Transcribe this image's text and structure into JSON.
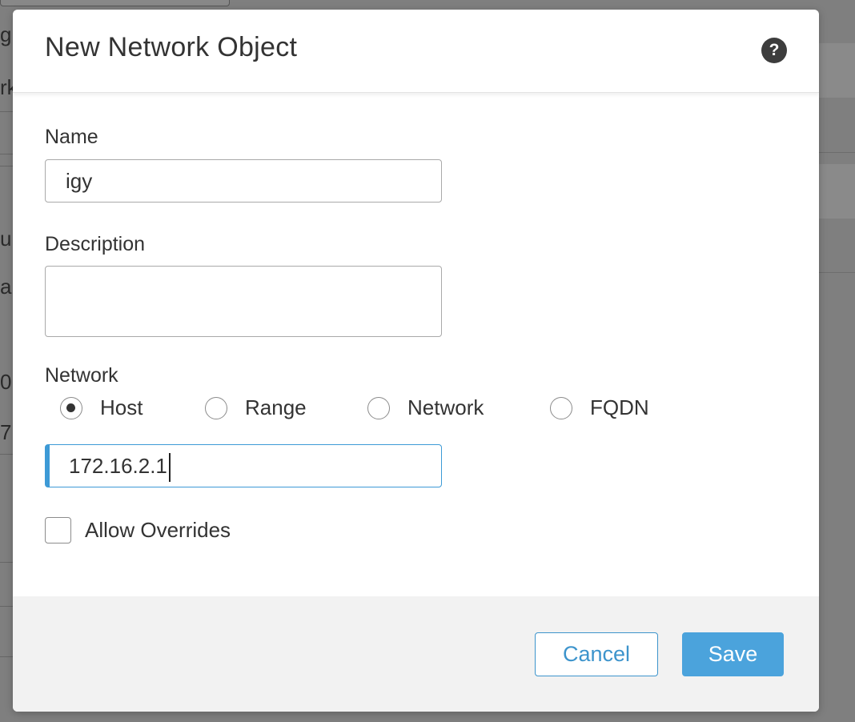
{
  "background": {
    "fragments": [
      "g",
      "rk",
      "ur",
      "al",
      "0",
      "7"
    ]
  },
  "dialog": {
    "title": "New Network Object",
    "help_icon": "question-mark-icon",
    "name": {
      "label": "Name",
      "value": "igy"
    },
    "description": {
      "label": "Description",
      "value": ""
    },
    "network": {
      "label": "Network",
      "options": [
        "Host",
        "Range",
        "Network",
        "FQDN"
      ],
      "selected": "Host",
      "value": "172.16.2.1"
    },
    "allow_overrides": {
      "label": "Allow Overrides",
      "checked": false
    },
    "buttons": {
      "cancel": "Cancel",
      "save": "Save"
    }
  },
  "colors": {
    "accent": "#4ba3dc",
    "overlay": "#7f7f7f",
    "footer_bg": "#f2f2f2"
  }
}
